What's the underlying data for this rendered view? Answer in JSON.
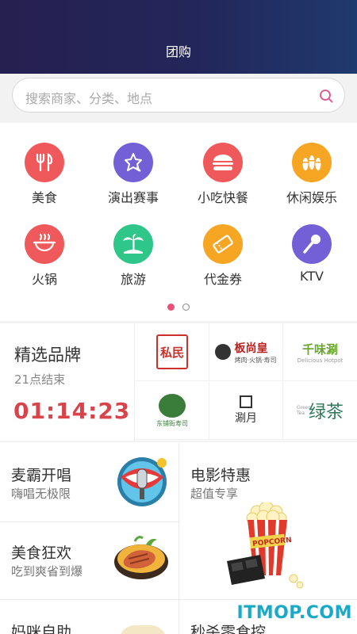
{
  "header": {
    "title": "团购"
  },
  "search": {
    "placeholder": "搜索商家、分类、地点",
    "icon": "search-icon"
  },
  "categories": [
    {
      "label": "美食",
      "icon": "fork-knife-icon",
      "color": "#f0595b"
    },
    {
      "label": "演出赛事",
      "icon": "star-icon",
      "color": "#7460d6"
    },
    {
      "label": "小吃快餐",
      "icon": "burger-icon",
      "color": "#f0595b"
    },
    {
      "label": "休闲娱乐",
      "icon": "bowling-icon",
      "color": "#f6a623"
    },
    {
      "label": "火锅",
      "icon": "hotpot-icon",
      "color": "#f0595b"
    },
    {
      "label": "旅游",
      "icon": "palm-tree-icon",
      "color": "#2fc68a"
    },
    {
      "label": "代金券",
      "icon": "ticket-icon",
      "color": "#f6a623"
    },
    {
      "label": "KTV",
      "icon": "microphone-icon",
      "color": "#7460d6"
    }
  ],
  "pager": {
    "total": 2,
    "active": 0
  },
  "brands": {
    "title": "精选品牌",
    "subtitle": "21点结束",
    "countdown": "01:14:23",
    "logos": [
      {
        "name": "私民",
        "color": "#c8322b"
      },
      {
        "name": "板尚皇",
        "sub": "烤肉·火锅·寿司",
        "color": "#b5201f"
      },
      {
        "name": "千味涮",
        "sub": "Delicious Hotpot",
        "color": "#6aa532"
      },
      {
        "name": "东铺街寿司",
        "color": "#3a7c3a"
      },
      {
        "name": "涮月",
        "color": "#333333"
      },
      {
        "name": "绿茶",
        "sub": "Green Tea",
        "color": "#2f7a5a"
      }
    ]
  },
  "promos": [
    {
      "title": "麦霸开唱",
      "subtitle": "嗨唱无极限"
    },
    {
      "title": "电影特惠",
      "subtitle": "超值专享"
    },
    {
      "title": "美食狂欢",
      "subtitle": "吃到爽省到爆"
    },
    {
      "title": "妈咪自助",
      "subtitle": ""
    },
    {
      "title": "秒杀零食控",
      "subtitle": ""
    }
  ],
  "watermark": "ITMOP.COM"
}
